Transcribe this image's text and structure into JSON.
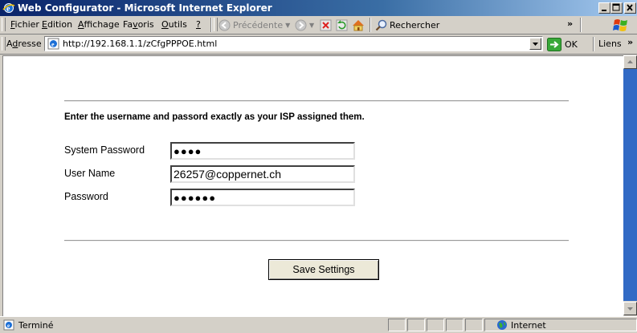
{
  "window": {
    "title": "Web Configurator - Microsoft Internet Explorer"
  },
  "menu": {
    "items": [
      {
        "pre": "",
        "u": "F",
        "post": "ichier"
      },
      {
        "pre": "",
        "u": "E",
        "post": "dition"
      },
      {
        "pre": "",
        "u": "A",
        "post": "ffichage"
      },
      {
        "pre": "Fa",
        "u": "v",
        "post": "oris"
      },
      {
        "pre": "",
        "u": "O",
        "post": "utils"
      },
      {
        "pre": "",
        "u": "?",
        "post": ""
      }
    ]
  },
  "toolbar": {
    "back_label": "Précédente",
    "search_label": "Rechercher"
  },
  "address": {
    "label_u": "d",
    "label_pre": "A",
    "label_post": "resse",
    "url": "http://192.168.1.1/zCfgPPPOE.html",
    "go_label": "OK",
    "links_label": "Liens"
  },
  "page": {
    "instruction": "Enter the username and passord exactly as your ISP assigned them.",
    "fields": [
      {
        "label": "System Password",
        "value": "●●●●"
      },
      {
        "label": "User Name",
        "value": "26257@coppernet.ch"
      },
      {
        "label": "Password",
        "value": "●●●●●●"
      }
    ],
    "save_button": "Save Settings"
  },
  "status": {
    "text": "Terminé",
    "zone": "Internet"
  },
  "colors": {
    "titlebar_start": "#0a246a",
    "scroll_thumb": "#316ac5"
  }
}
